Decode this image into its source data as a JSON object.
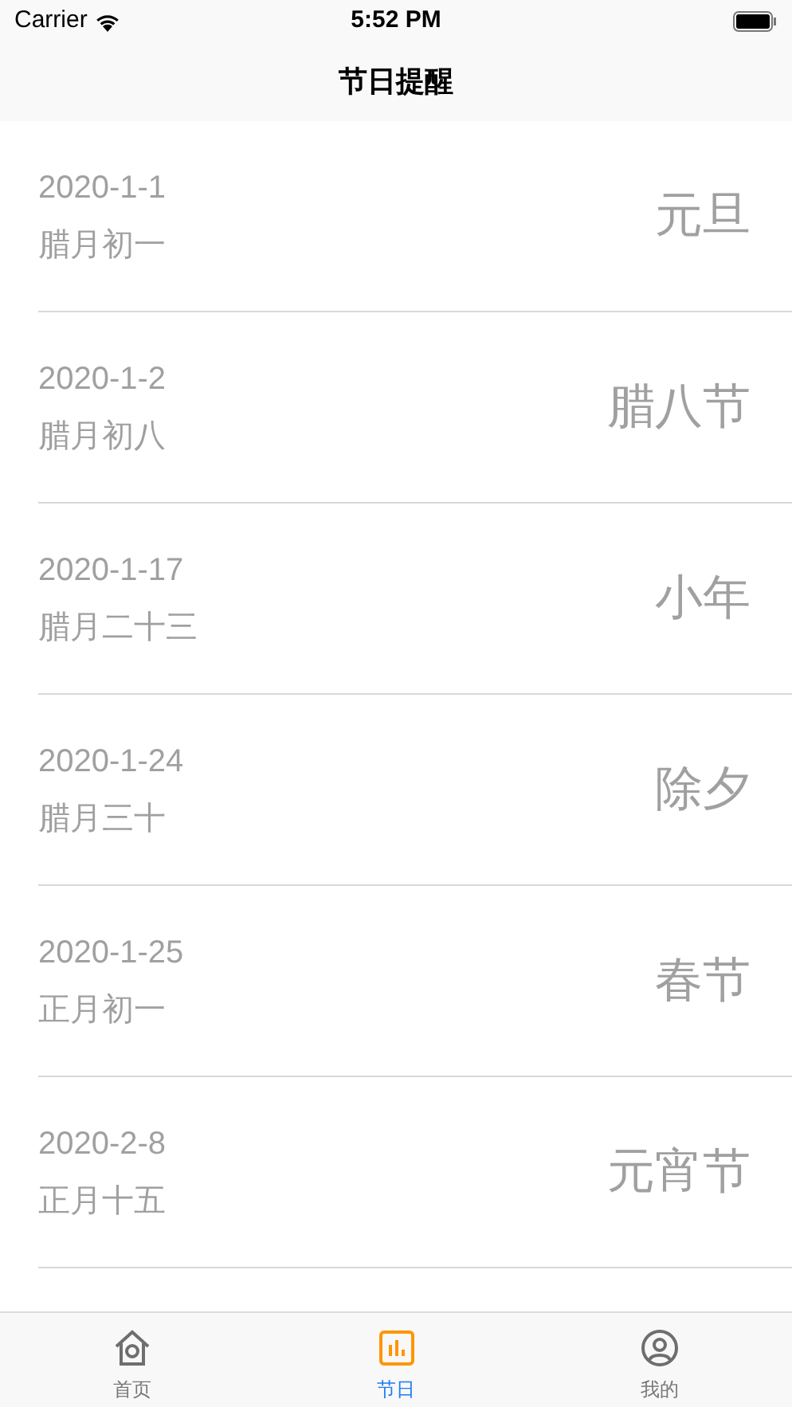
{
  "status_bar": {
    "carrier": "Carrier",
    "time": "5:52 PM"
  },
  "nav_bar": {
    "title": "节日提醒"
  },
  "holidays": [
    {
      "date": "2020-1-1",
      "lunar": "腊月初一",
      "name": "元旦"
    },
    {
      "date": "2020-1-2",
      "lunar": "腊月初八",
      "name": "腊八节"
    },
    {
      "date": "2020-1-17",
      "lunar": "腊月二十三",
      "name": "小年"
    },
    {
      "date": "2020-1-24",
      "lunar": "腊月三十",
      "name": "除夕"
    },
    {
      "date": "2020-1-25",
      "lunar": "正月初一",
      "name": "春节"
    },
    {
      "date": "2020-2-8",
      "lunar": "正月十五",
      "name": "元宵节"
    }
  ],
  "tab_bar": [
    {
      "kind": "home",
      "label": "首页",
      "selected": false
    },
    {
      "kind": "chart",
      "label": "节日",
      "selected": true
    },
    {
      "kind": "profile",
      "label": "我的",
      "selected": false
    }
  ]
}
